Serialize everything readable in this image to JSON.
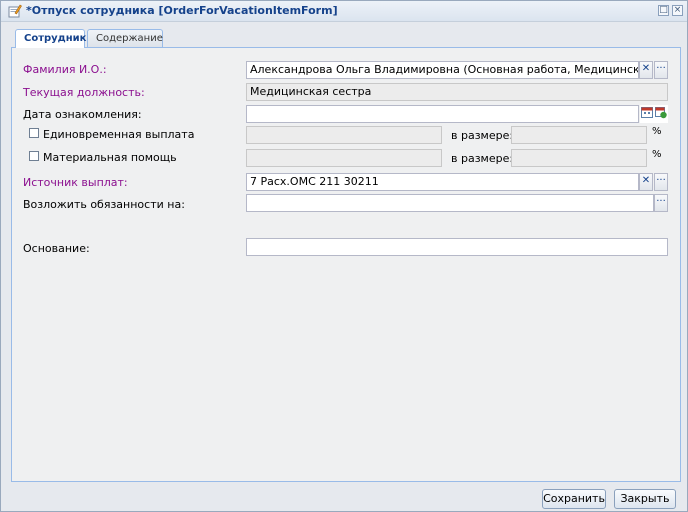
{
  "window": {
    "title": "*Отпуск сотрудника [OrderForVacationItemForm]"
  },
  "tabs": [
    "Сотрудник",
    "Содержание"
  ],
  "form": {
    "employee_label": "Фамилия И.О.:",
    "employee_value": "Александрова Ольга Владимировна (Основная работа, Медицинская сестра, Кон",
    "position_label": "Текущая должность:",
    "position_value": "Медицинская сестра",
    "acquaint_date_label": "Дата ознакомления:",
    "acquaint_date_value": "",
    "lump_sum_label": "Единовременная выплата",
    "material_aid_label": "Материальная помощь",
    "amount_label": "в размере:",
    "percent": "%",
    "payment_source_label": "Источник выплат:",
    "payment_source_value": "7 Расх.ОМС 211 30211",
    "duties_label": "Возложить обязанности на:",
    "duties_value": "",
    "basis_label": "Основание:",
    "basis_value": ""
  },
  "footer": {
    "save_label": "Сохранить",
    "close_label": "Закрыть"
  }
}
